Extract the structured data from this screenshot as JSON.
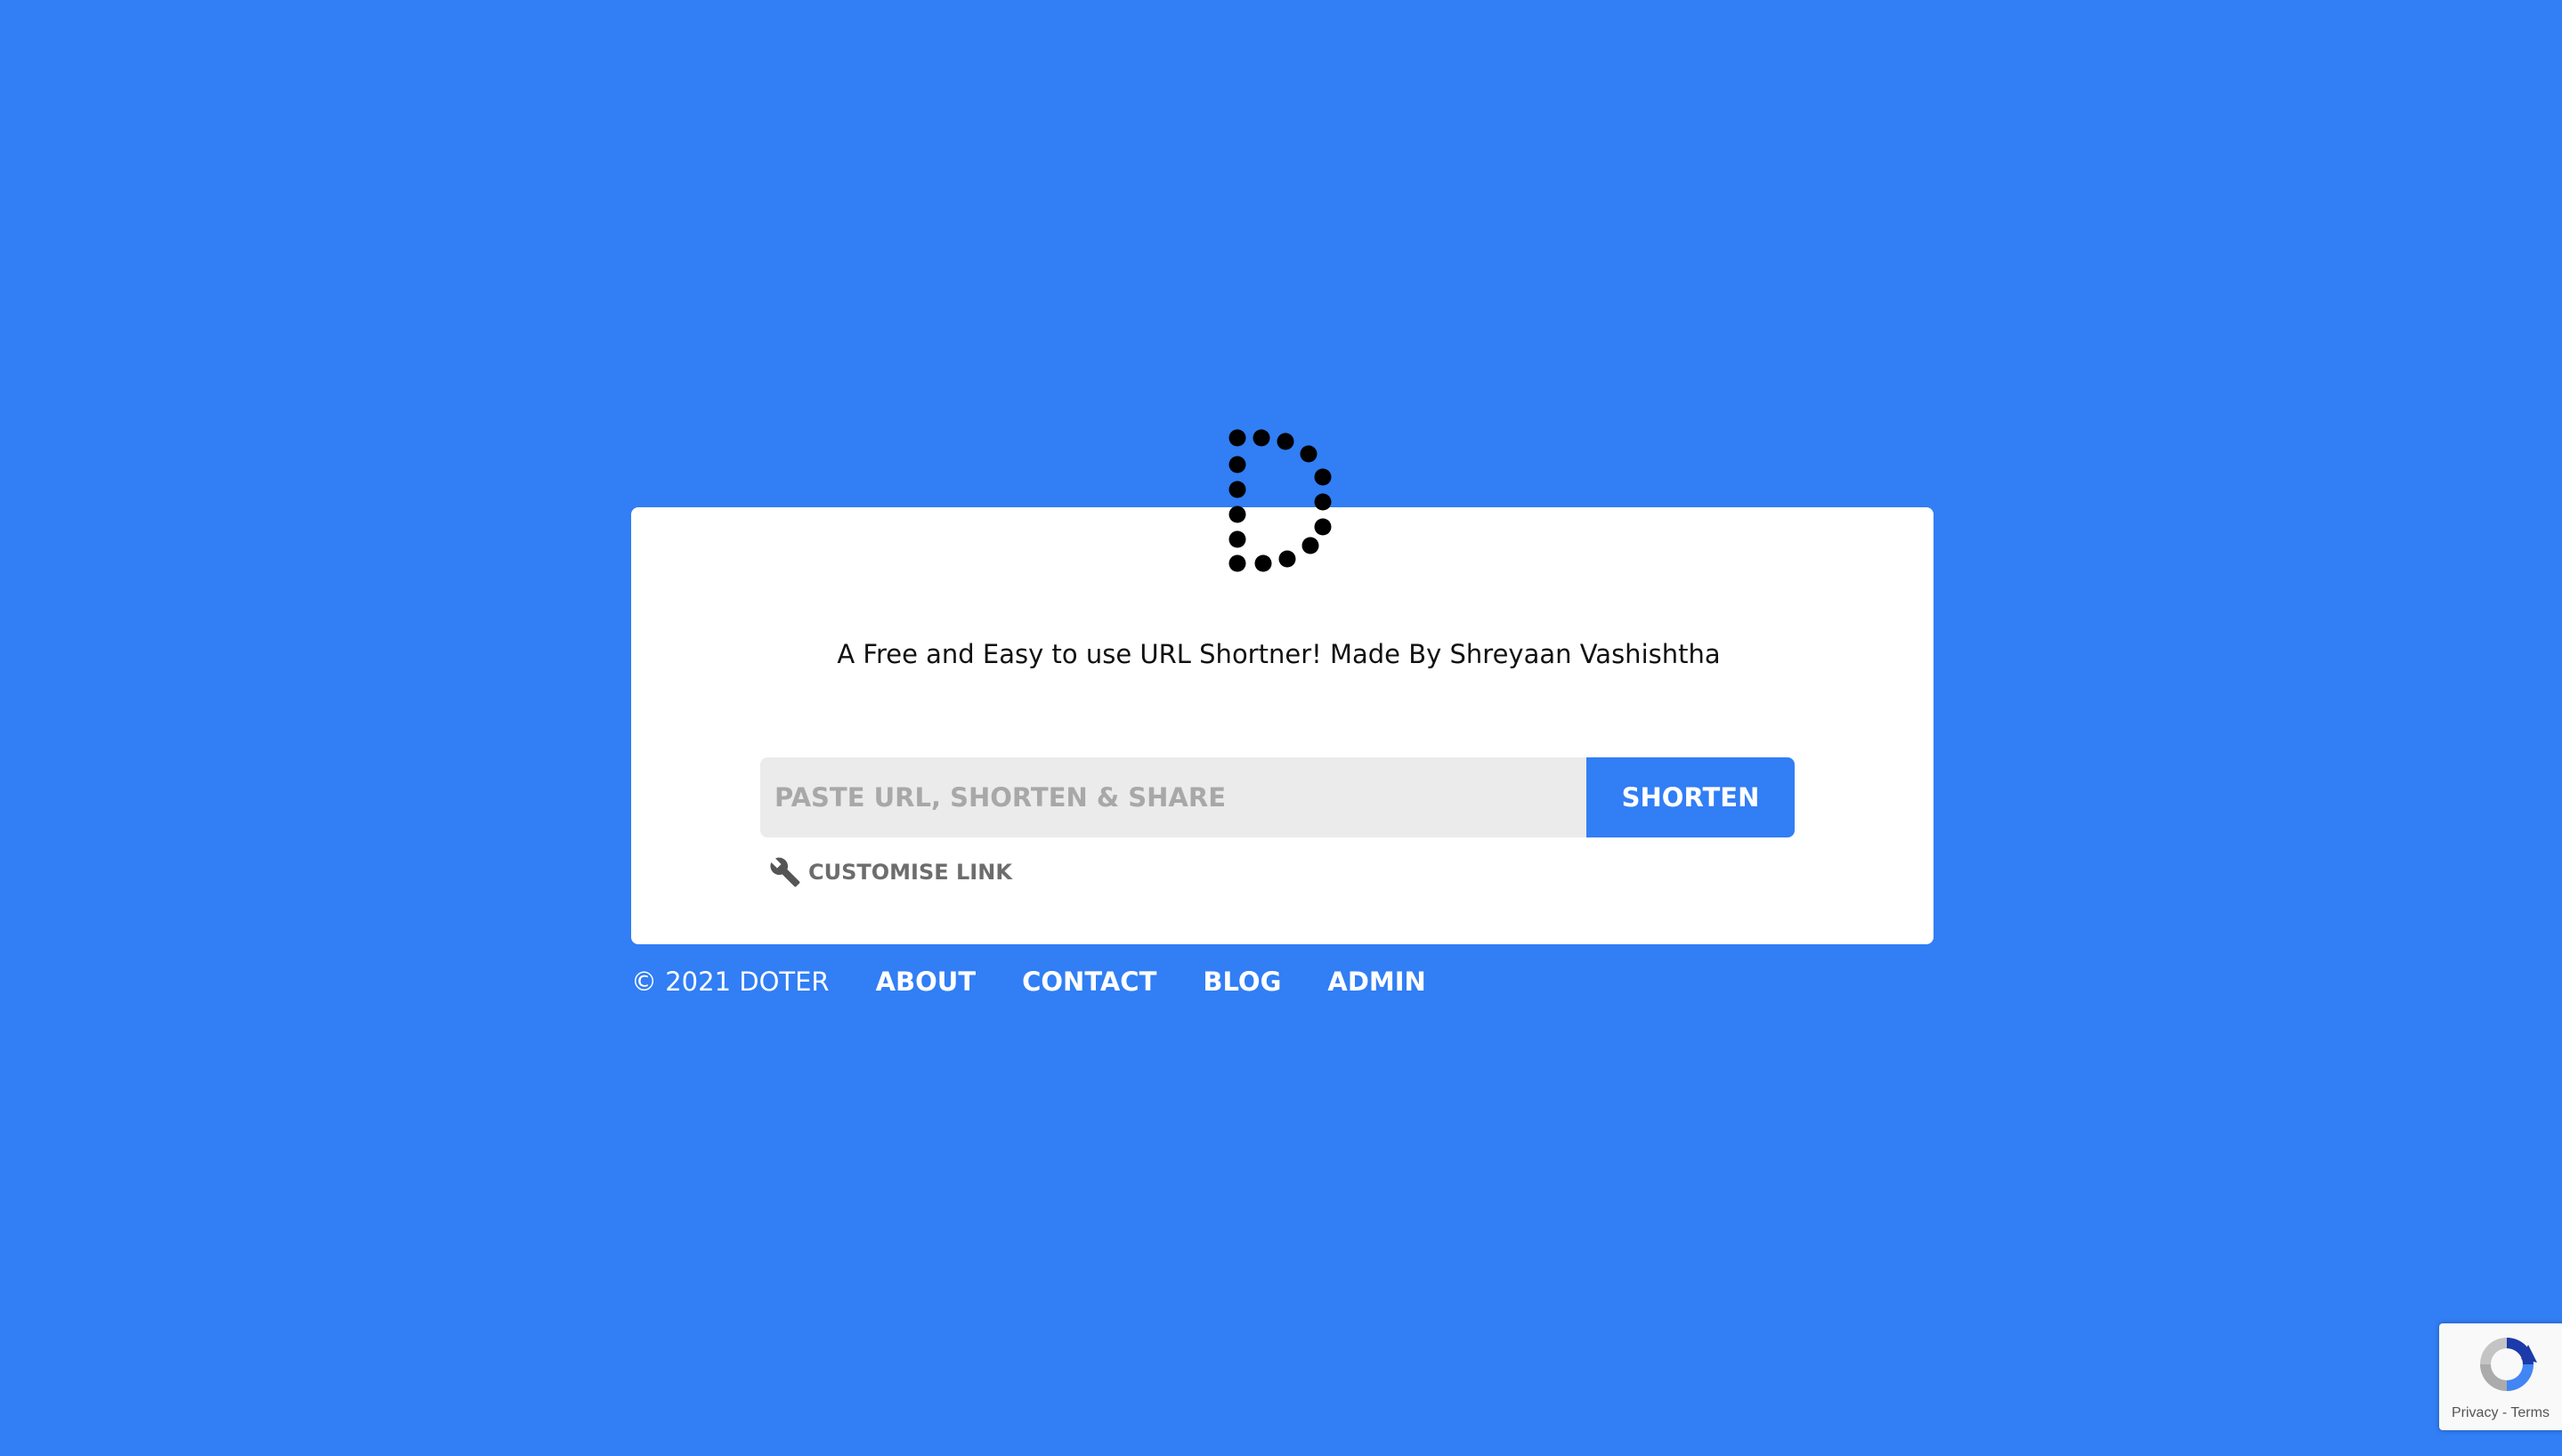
{
  "theme": {
    "background": "#317ef5",
    "card": "#ffffff",
    "accent": "#317ef5"
  },
  "logo": {
    "icon": "dotted-d-logo-icon"
  },
  "main": {
    "tagline": "A Free and Easy to use URL Shortner! Made By Shreyaan Vashishtha",
    "url_input": {
      "placeholder": "PASTE URL, SHORTEN & SHARE",
      "value": ""
    },
    "shorten_label": "SHORTEN",
    "customise": {
      "icon": "wrench-icon",
      "label": "CUSTOMISE LINK"
    }
  },
  "footer": {
    "copyright": "© 2021 DOTER",
    "links": [
      "ABOUT",
      "CONTACT",
      "BLOG",
      "ADMIN"
    ]
  },
  "recaptcha": {
    "icon": "recaptcha-icon",
    "privacy": "Privacy",
    "separator": " - ",
    "terms": "Terms"
  }
}
